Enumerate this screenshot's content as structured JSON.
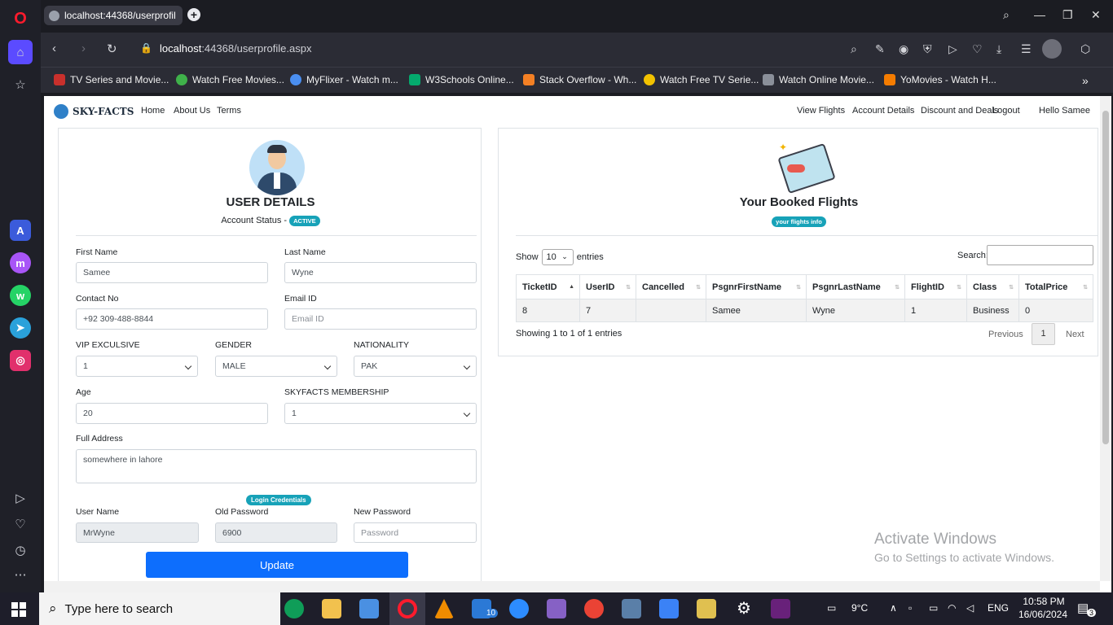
{
  "browser": {
    "tab_title": "localhost:44368/userprofil",
    "url_host": "localhost",
    "url_rest": ":44368/userprofile.aspx",
    "bookmarks": [
      "TV Series and Movie...",
      "Watch Free Movies...",
      "MyFlixer - Watch m...",
      "W3Schools Online...",
      "Stack Overflow - Wh...",
      "Watch Free TV Serie...",
      "Watch Online Movie...",
      "YoMovies - Watch H..."
    ]
  },
  "site": {
    "brand": "SKY-FACTS",
    "nav_left": [
      "Home",
      "About Us",
      "Terms"
    ],
    "nav_right": [
      "View Flights",
      "Account Details",
      "Discount and Deals",
      "Logout",
      "Hello Samee"
    ]
  },
  "user_card": {
    "title": "USER DETAILS",
    "status_label": "Account Status -",
    "status_badge": "ACTIVE",
    "fields": {
      "first_name": {
        "label": "First Name",
        "value": "Samee"
      },
      "last_name": {
        "label": "Last Name",
        "value": "Wyne"
      },
      "contact": {
        "label": "Contact No",
        "value": "+92 309-488-8844"
      },
      "email": {
        "label": "Email ID",
        "placeholder": "Email ID"
      },
      "vip": {
        "label": "VIP EXCULSIVE",
        "value": "1"
      },
      "gender": {
        "label": "GENDER",
        "value": "MALE"
      },
      "nationality": {
        "label": "NATIONALITY",
        "value": "PAK"
      },
      "age": {
        "label": "Age",
        "value": "20"
      },
      "membership": {
        "label": "SKYFACTS MEMBERSHIP",
        "value": "1"
      },
      "address": {
        "label": "Full Address",
        "value": "somewhere in lahore"
      },
      "username": {
        "label": "User Name",
        "value": "MrWyne"
      },
      "old_password": {
        "label": "Old Password",
        "value": "6900"
      },
      "new_password": {
        "label": "New Password",
        "placeholder": "Password"
      }
    },
    "credentials_badge": "Login Credentials",
    "update_button": "Update"
  },
  "flights_card": {
    "title": "Your Booked Flights",
    "badge": "your flights info",
    "show_label": "Show",
    "show_value": "10",
    "entries_label": "entries",
    "search_label": "Search:",
    "columns": [
      "TicketID",
      "UserID",
      "Cancelled",
      "PsgnrFirstName",
      "PsgnrLastName",
      "FlightID",
      "Class",
      "TotalPrice"
    ],
    "rows": [
      [
        "8",
        "7",
        "",
        "Samee",
        "Wyne",
        "1",
        "Business",
        "0"
      ]
    ],
    "info": "Showing 1 to 1 of 1 entries",
    "pager": {
      "previous": "Previous",
      "page": "1",
      "next": "Next"
    }
  },
  "watermark": {
    "line1": "Activate Windows",
    "line2": "Go to Settings to activate Windows."
  },
  "taskbar": {
    "search_placeholder": "Type here to search",
    "mail_count": "10",
    "weather": "9°C",
    "lang": "ENG",
    "time": "10:58 PM",
    "date": "16/06/2024",
    "notif_count": "3"
  }
}
